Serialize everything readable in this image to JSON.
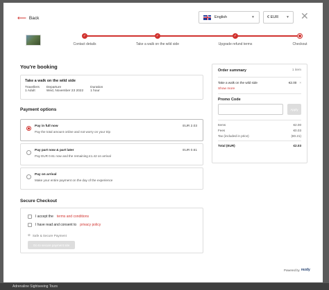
{
  "header": {
    "back_label": "Back",
    "language": "English",
    "currency": "€ EUR",
    "close_glyph": "✕"
  },
  "steps": [
    {
      "label": "Contact details",
      "state": "done"
    },
    {
      "label": "Take a walk on the wild side",
      "state": "done"
    },
    {
      "label": "Upgrade refund terms",
      "state": "done"
    },
    {
      "label": "Checkout",
      "state": "current"
    }
  ],
  "booking": {
    "heading": "You're booking",
    "tour_title": "Take a walk on the wild side",
    "travellers_label": "Travellers",
    "travellers_value": "1 Adult",
    "departure_label": "Departure",
    "departure_value": "Wed, November 23 2022",
    "duration_label": "Duration",
    "duration_value": "1 hour"
  },
  "payment": {
    "heading": "Payment options",
    "options": [
      {
        "name": "Pay in full now",
        "desc": "Pay the total amount online and not worry on your trip",
        "amount": "EUR 2.03",
        "selected": true
      },
      {
        "name": "Pay part now & part later",
        "desc": "Pay EUR 0.61 now and the remaining £1.42 on arrival",
        "amount": "EUR 0.61",
        "selected": false
      },
      {
        "name": "Pay on arrival",
        "desc": "Make your entire payment on the day of the experience",
        "amount": "",
        "selected": false
      }
    ]
  },
  "checkout": {
    "heading": "Secure Checkout",
    "terms_prefix": "I accept the ",
    "terms_link": "terms and conditions",
    "privacy_prefix": "I have read and consent to ",
    "privacy_link": "privacy policy",
    "secure_label": "Safe & Secure Payment",
    "pay_button": "Go to secure payment site"
  },
  "summary": {
    "heading": "Order summary",
    "count": "1 item",
    "item_name": "Take a walk on the wild side",
    "item_price": "€2.00",
    "remove_glyph": "×",
    "show_more": "Show more",
    "promo_heading": "Promo Code",
    "apply_label": "Apply",
    "items_label": "Items",
    "items_value": "€2.00",
    "fees_label": "Fees",
    "fees_value": "€0.03",
    "tax_label": "Tax (included in price)",
    "tax_value": "(€0.21)",
    "total_label": "Total (EUR)",
    "total_value": "€2.03"
  },
  "footer": {
    "powered_label": "Powered by",
    "brand": "rezdy"
  },
  "background_text": "Adrenaline Sightseeing Tours",
  "colors": {
    "accent": "#d0312d"
  }
}
